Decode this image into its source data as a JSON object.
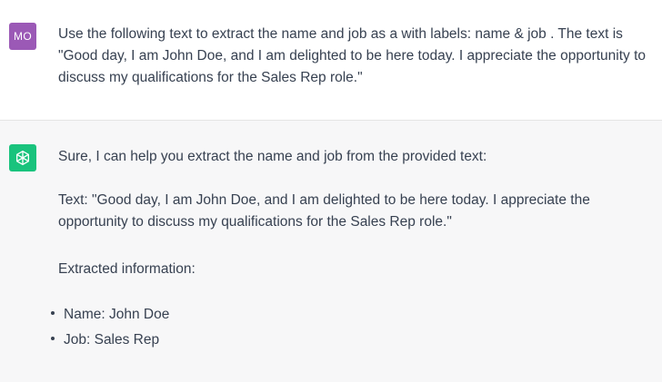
{
  "user_message": {
    "avatar_initials": "MO",
    "avatar_color": "#9b59b6",
    "text": "Use the following text to extract the name and job as a with labels: name & job . The text is \"Good day, I am John Doe, and I am delighted to be here today. I appreciate the opportunity to discuss my qualifications for the Sales Rep role.\""
  },
  "assistant_message": {
    "avatar_icon": "openai-logo-icon",
    "avatar_color": "#19c37d",
    "intro": "Sure, I can help you extract the name and job from the provided text:",
    "quoted_text": "Text: \"Good day, I am John Doe, and I am delighted to be here today. I appreciate the opportunity to discuss my qualifications for the Sales Rep role.\"",
    "extracted_heading": "Extracted information:",
    "items": [
      "Name: John Doe",
      "Job: Sales Rep"
    ]
  }
}
